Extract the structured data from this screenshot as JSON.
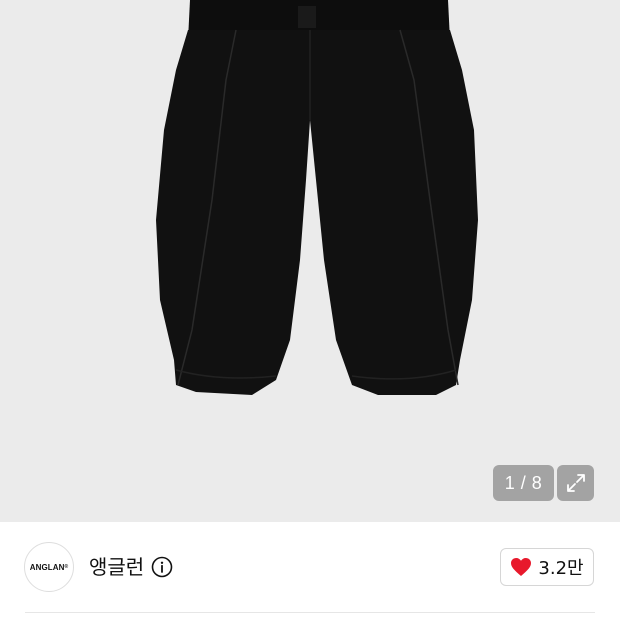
{
  "gallery": {
    "image_icon": "black-balloon-pants-image",
    "counter_text": "1 / 8",
    "expand_icon": "expand-icon"
  },
  "brand": {
    "logo_text": "ANGLAN",
    "logo_mark": "®",
    "name": "앵글런",
    "info_icon": "info-icon"
  },
  "likes": {
    "icon": "heart-icon",
    "count": "3.2만",
    "heart_color": "#e8192c"
  }
}
